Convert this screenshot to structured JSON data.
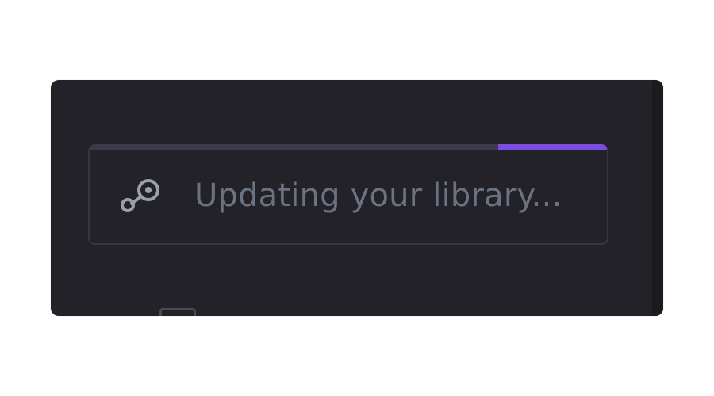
{
  "status": {
    "message": "Updating your library...",
    "icon": "steam-icon",
    "progress_percent": 21,
    "accent_color": "#7c4ce0"
  }
}
